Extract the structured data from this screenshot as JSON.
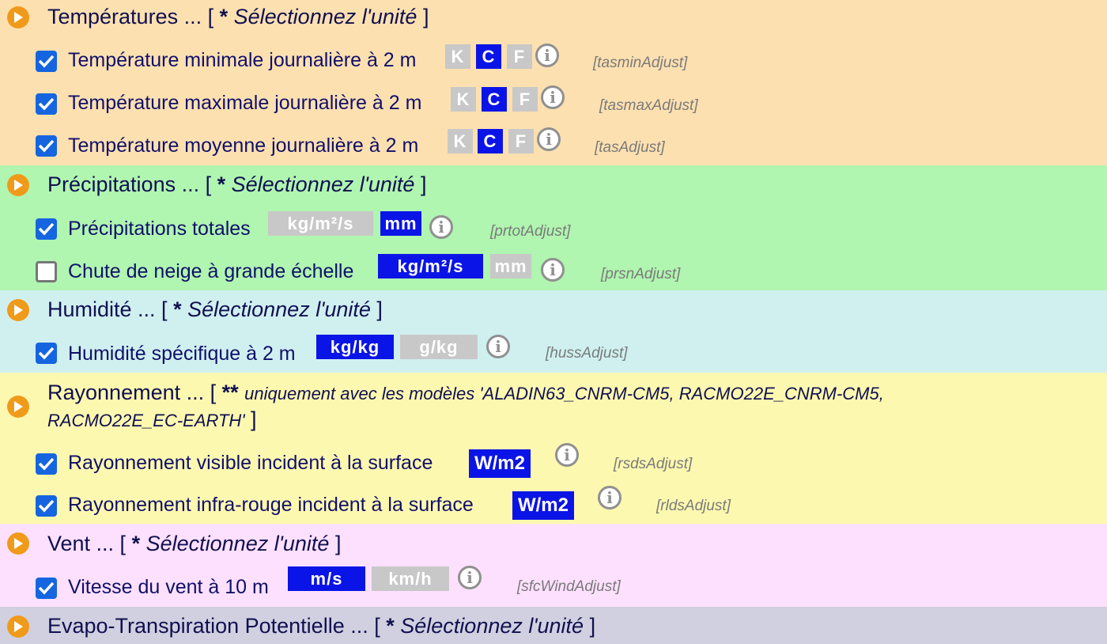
{
  "colors": {
    "temp": "#fde0b0",
    "precip": "#b0f5b0",
    "hum": "#d0f0f0",
    "ray": "#fdf8b0",
    "vent": "#fde0fd",
    "etp": "#d0d0e0",
    "unit_on": "#0b14e6",
    "unit_off": "#c8c8c8",
    "play": "#f09a1a"
  },
  "sections": [
    {
      "title": "Températures ... [",
      "star": "*",
      "select": "Sélectionnez l'unité",
      "close": "]",
      "rows": [
        {
          "label": "Température minimale journalière à 2 m",
          "checked": true,
          "units": [
            "K",
            "C",
            "F"
          ],
          "active": "C",
          "code": "[tasminAdjust]"
        },
        {
          "label": "Température maximale journalière à 2 m",
          "checked": true,
          "units": [
            "K",
            "C",
            "F"
          ],
          "active": "C",
          "code": "[tasmaxAdjust]"
        },
        {
          "label": "Température moyenne journalière à 2 m",
          "checked": true,
          "units": [
            "K",
            "C",
            "F"
          ],
          "active": "C",
          "code": "[tasAdjust]"
        }
      ]
    },
    {
      "title": "Précipitations ... [",
      "star": "*",
      "select": "Sélectionnez l'unité",
      "close": "]",
      "rows": [
        {
          "label": "Précipitations totales",
          "checked": true,
          "units": [
            "kg/m²/s",
            "mm"
          ],
          "active": "mm",
          "code": "[prtotAdjust]"
        },
        {
          "label": "Chute de neige à grande échelle",
          "checked": false,
          "units": [
            "kg/m²/s",
            "mm"
          ],
          "active": "kg/m²/s",
          "code": "[prsnAdjust]"
        }
      ]
    },
    {
      "title": "Humidité ... [",
      "star": "*",
      "select": "Sélectionnez l'unité",
      "close": "]",
      "rows": [
        {
          "label": "Humidité spécifique à 2 m",
          "checked": true,
          "units": [
            "kg/kg",
            "g/kg"
          ],
          "active": "kg/kg",
          "code": "[hussAdjust]"
        }
      ]
    },
    {
      "title": "Rayonnement ... [",
      "star": "**",
      "note_line1": "uniquement avec les modèles 'ALADIN63_CNRM-CM5, RACMO22E_CNRM-CM5,",
      "note_line2": "RACMO22E_EC-EARTH'",
      "close": "]",
      "rows": [
        {
          "label": "Rayonnement visible incident à la surface",
          "checked": true,
          "units": [
            "W/m2"
          ],
          "active": "W/m2",
          "code": "[rsdsAdjust]"
        },
        {
          "label": "Rayonnement infra-rouge incident à la surface",
          "checked": true,
          "units": [
            "W/m2"
          ],
          "active": "W/m2",
          "code": "[rldsAdjust]"
        }
      ]
    },
    {
      "title": "Vent ... [",
      "star": "*",
      "select": "Sélectionnez l'unité",
      "close": "]",
      "rows": [
        {
          "label": "Vitesse du vent à 10 m",
          "checked": true,
          "units": [
            "m/s",
            "km/h"
          ],
          "active": "m/s",
          "code": "[sfcWindAdjust]"
        }
      ]
    },
    {
      "title": "Evapo-Transpiration Potentielle ... [",
      "star": "*",
      "select": "Sélectionnez l'unité",
      "close": "]",
      "rows": []
    }
  ]
}
